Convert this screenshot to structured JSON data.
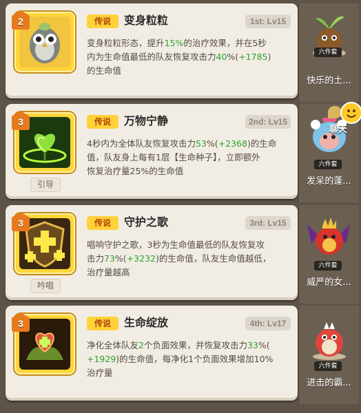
{
  "skills": [
    {
      "level": "2",
      "rarity": "传说",
      "name": "变身粒粒",
      "rank": "1st: Lv15",
      "tag": "",
      "desc": [
        [
          {
            "t": "变身粒粒形态，提升"
          },
          {
            "t": "15%",
            "hl": true
          },
          {
            "t": "的治疗效果，并在5秒"
          }
        ],
        [
          {
            "t": "内为生命值最低的队友恢复攻击力"
          },
          {
            "t": "40",
            "hl": true
          },
          {
            "t": "%("
          },
          {
            "t": "+1785",
            "hl": true
          },
          {
            "t": ")"
          }
        ],
        [
          {
            "t": "的生命值"
          }
        ]
      ]
    },
    {
      "level": "3",
      "rarity": "传说",
      "name": "万物宁静",
      "rank": "2nd: Lv15",
      "tag": "引导",
      "desc": [
        [
          {
            "t": "4秒内为全体队友恢复攻击力"
          },
          {
            "t": "53",
            "hl": true
          },
          {
            "t": "%("
          },
          {
            "t": "+2368",
            "hl": true
          },
          {
            "t": ")的生命"
          }
        ],
        [
          {
            "t": "值，队友身上每有1层【生命种子】，立即额外"
          }
        ],
        [
          {
            "t": "恢复治疗量25%的生命值"
          }
        ]
      ]
    },
    {
      "level": "3",
      "rarity": "传说",
      "name": "守护之歌",
      "rank": "3rd: Lv15",
      "tag": "吟唱",
      "desc": [
        [
          {
            "t": "唱响守护之歌，3秒为生命值最低的队友恢复攻"
          }
        ],
        [
          {
            "t": "击力"
          },
          {
            "t": "73",
            "hl": true
          },
          {
            "t": "%("
          },
          {
            "t": "+3232",
            "hl": true
          },
          {
            "t": ")的生命值，队友生命值越低，"
          }
        ],
        [
          {
            "t": "治疗量越高"
          }
        ]
      ]
    },
    {
      "level": "3",
      "rarity": "传说",
      "name": "生命绽放",
      "rank": "4th: Lv17",
      "tag": "",
      "desc": [
        [
          {
            "t": "净化全体队友"
          },
          {
            "t": "2",
            "hl": true
          },
          {
            "t": "个负面效果，并恢复攻击力"
          },
          {
            "t": "33",
            "hl": true
          },
          {
            "t": "%("
          }
        ],
        [
          {
            "t": "+1929",
            "hl": true
          },
          {
            "t": ")的生命值，每净化1个负面效果增加10%"
          }
        ],
        [
          {
            "t": "治疗量"
          }
        ]
      ]
    }
  ],
  "sets": [
    {
      "badge": "六件套",
      "name": "快乐的土..."
    },
    {
      "badge": "六件套",
      "name": "发呆的蓬..."
    },
    {
      "badge": "六件套",
      "name": "威严的女..."
    },
    {
      "badge": "六件套",
      "name": "进击的霸..."
    }
  ],
  "chat": {
    "label": "聊天"
  },
  "colors": {
    "highlight": "#2aa12a",
    "rarity_bg": "#ffd23a",
    "rarity_text": "#b3450a",
    "card_bg": "#f2ede4",
    "badge": "#e77a1c"
  }
}
